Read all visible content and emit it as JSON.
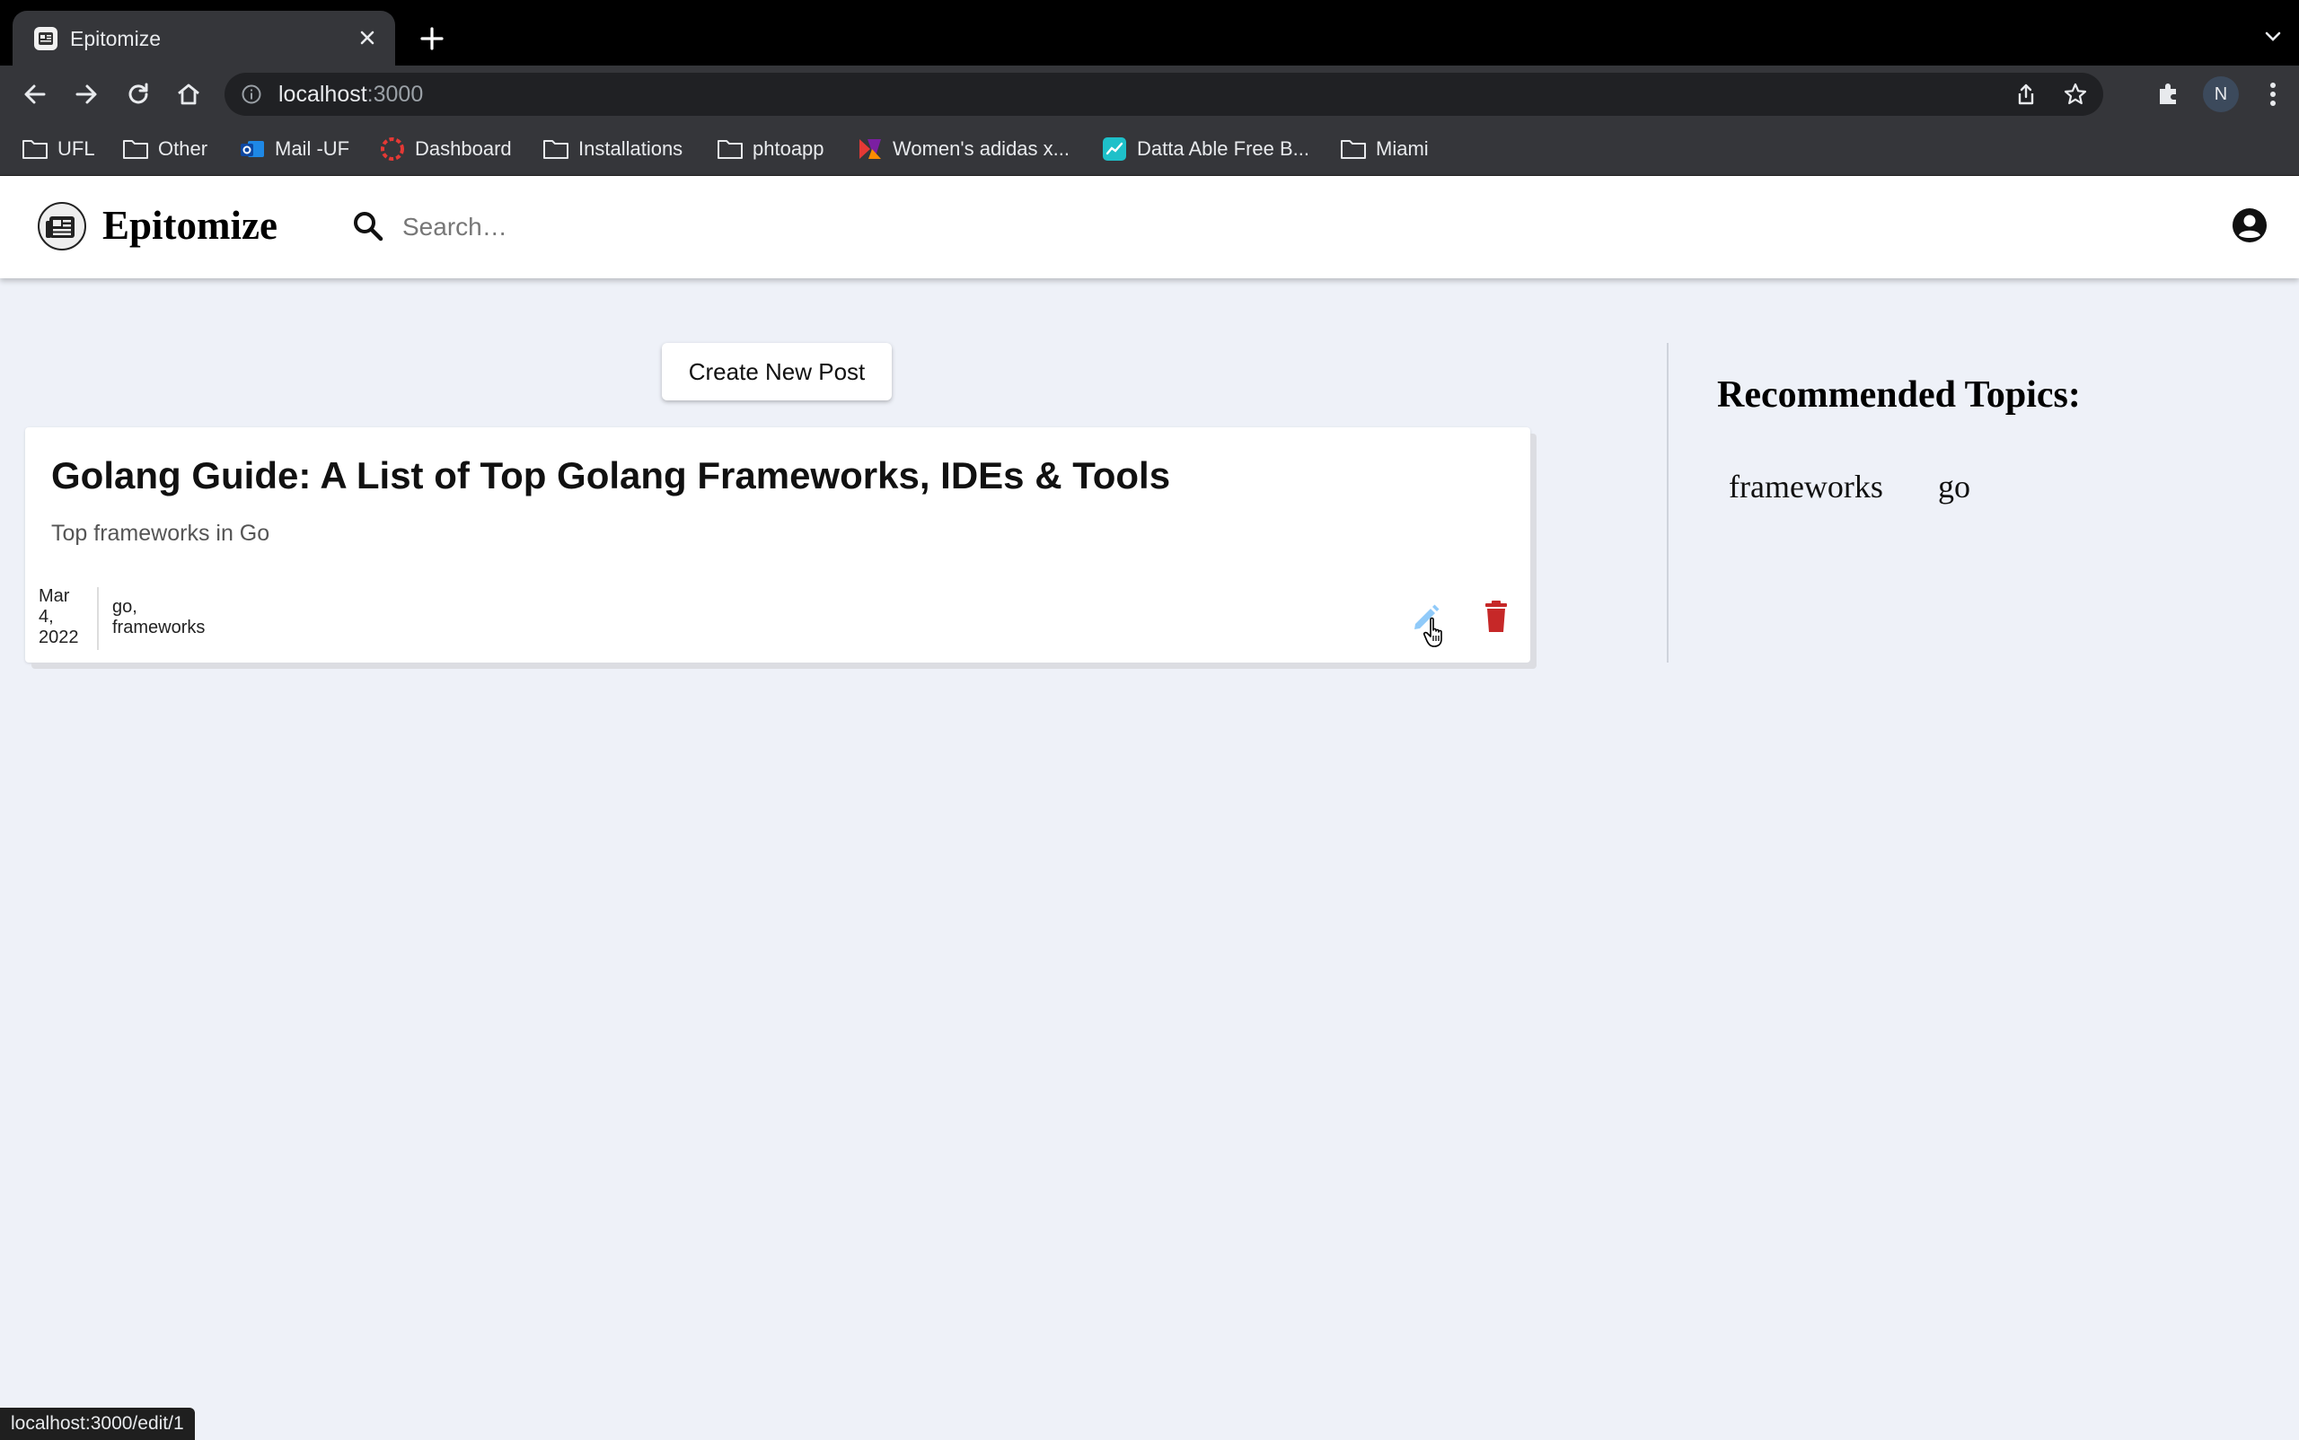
{
  "browser": {
    "tab": {
      "title": "Epitomize",
      "favicon": "newspaper-icon"
    },
    "address": {
      "host": "localhost",
      "port": ":3000"
    },
    "bookmarks": [
      {
        "label": "UFL",
        "icon": "folder-icon"
      },
      {
        "label": "Other",
        "icon": "folder-icon"
      },
      {
        "label": "Mail -UF",
        "icon": "outlook-icon"
      },
      {
        "label": "Dashboard",
        "icon": "dashboard-icon"
      },
      {
        "label": "Installations",
        "icon": "folder-icon"
      },
      {
        "label": "phtoapp",
        "icon": "folder-icon"
      },
      {
        "label": "Women's adidas x...",
        "icon": "adidas-icon"
      },
      {
        "label": "Datta Able Free B...",
        "icon": "chart-icon"
      },
      {
        "label": "Miami",
        "icon": "folder-icon"
      }
    ],
    "profile_initial": "N",
    "status_url": "localhost:3000/edit/1"
  },
  "app": {
    "brand": "Epitomize",
    "search_placeholder": "Search…",
    "create_button": "Create New Post",
    "posts": [
      {
        "title": "Golang Guide: A List of Top Golang Frameworks, IDEs & Tools",
        "description": "Top frameworks in Go",
        "date_lines": [
          "Mar",
          "4,",
          "2022"
        ],
        "tag_lines": [
          "go,",
          "frameworks"
        ]
      }
    ],
    "sidebar": {
      "heading": "Recommended Topics:",
      "topics": [
        "frameworks",
        "go"
      ]
    },
    "colors": {
      "delete": "#c62828",
      "edit": "#90caf9",
      "background": "#eef1f8"
    }
  }
}
